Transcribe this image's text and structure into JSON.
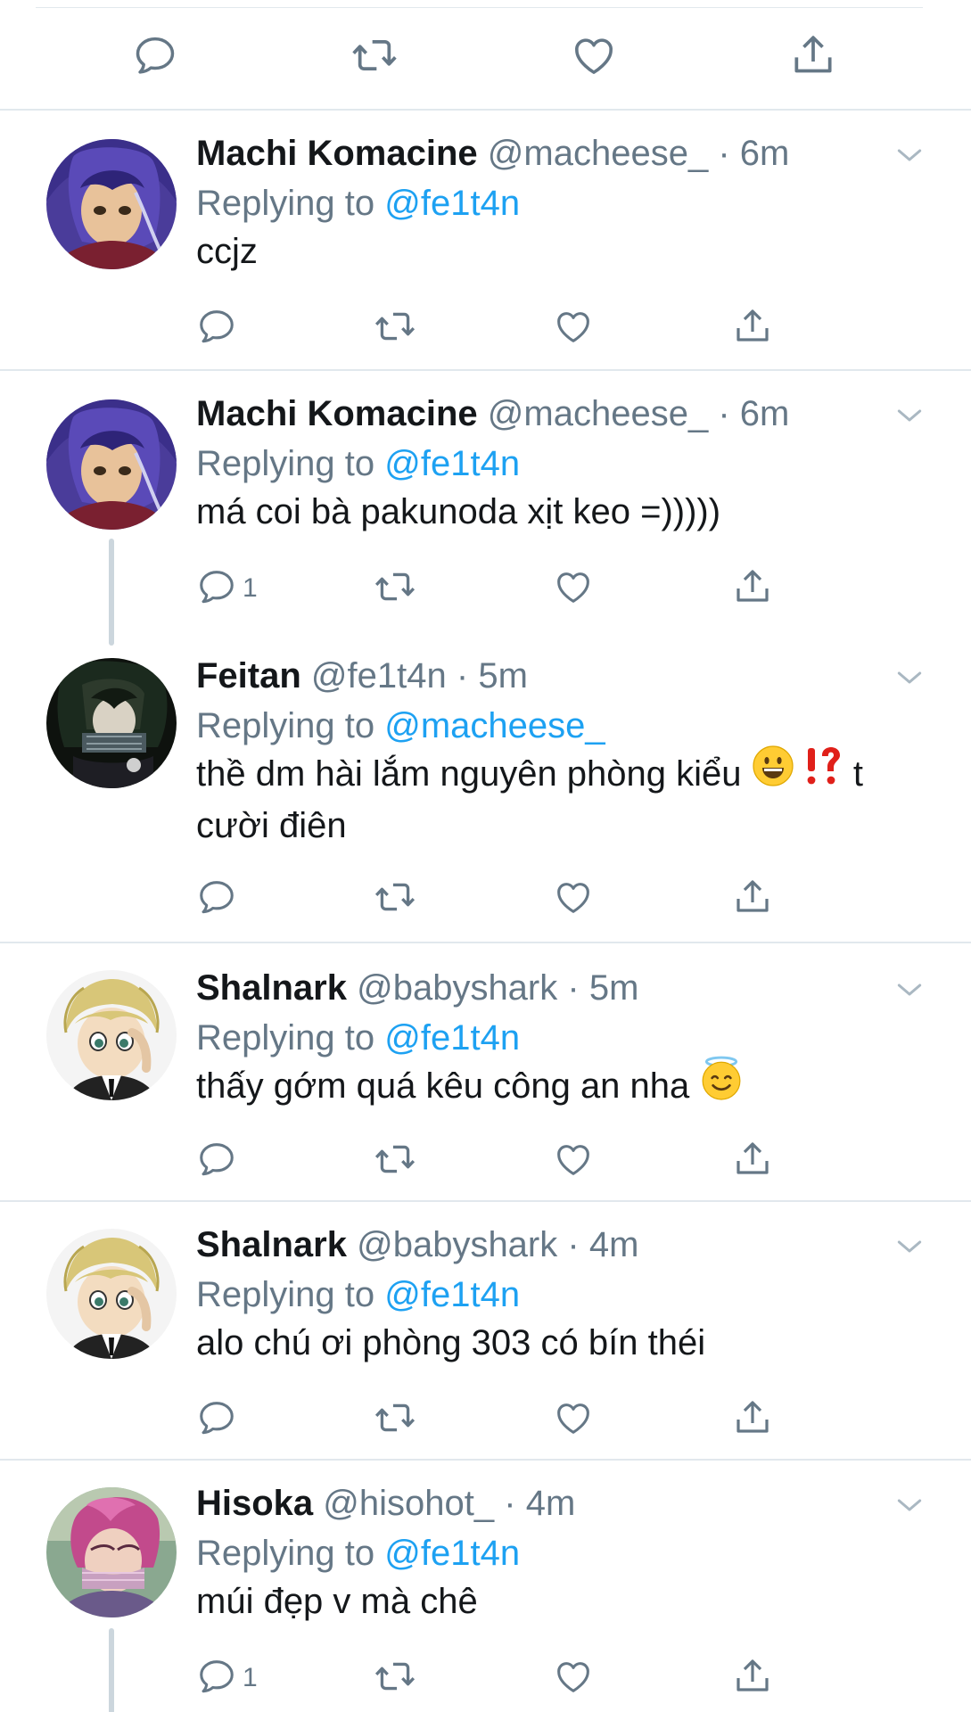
{
  "colors": {
    "accent": "#1da1f2",
    "secondary_text": "#657786",
    "divider": "#e1e8ed",
    "icon": "#657786"
  },
  "top_actions": {
    "icons": [
      "reply-icon",
      "retweet-icon",
      "like-icon",
      "share-icon"
    ]
  },
  "tweets": [
    {
      "name": "Machi Komacine",
      "handle": "@macheese_",
      "dot": "·",
      "time": "6m",
      "replying_prefix": "Replying to",
      "replying_to": "@fe1t4n",
      "text": "ccjz",
      "reply_count": ""
    },
    {
      "name": "Machi Komacine",
      "handle": "@macheese_",
      "dot": "·",
      "time": "6m",
      "replying_prefix": "Replying to",
      "replying_to": "@fe1t4n",
      "text": "má coi bà pakunoda xịt keo =)))))",
      "reply_count": "1"
    },
    {
      "name": "Feitan",
      "handle": "@fe1t4n",
      "dot": "·",
      "time": "5m",
      "replying_prefix": "Replying to",
      "replying_to": "@macheese_",
      "text_part1": "thề dm hài lắm nguyên phòng kiểu",
      "text_part2": "t",
      "text_line2": "cười điên",
      "reply_count": ""
    },
    {
      "name": "Shalnark",
      "handle": "@babyshark",
      "dot": "·",
      "time": "5m",
      "replying_prefix": "Replying to",
      "replying_to": "@fe1t4n",
      "text": "thấy gớm quá kêu công an nha",
      "reply_count": ""
    },
    {
      "name": "Shalnark",
      "handle": "@babyshark",
      "dot": "·",
      "time": "4m",
      "replying_prefix": "Replying to",
      "replying_to": "@fe1t4n",
      "text": "alo chú ơi phòng 303 có bín théi",
      "reply_count": ""
    },
    {
      "name": "Hisoka",
      "handle": "@hisohot_",
      "dot": "·",
      "time": "4m",
      "replying_prefix": "Replying to",
      "replying_to": "@fe1t4n",
      "text": "múi đẹp v mà chê",
      "reply_count": "1"
    }
  ]
}
